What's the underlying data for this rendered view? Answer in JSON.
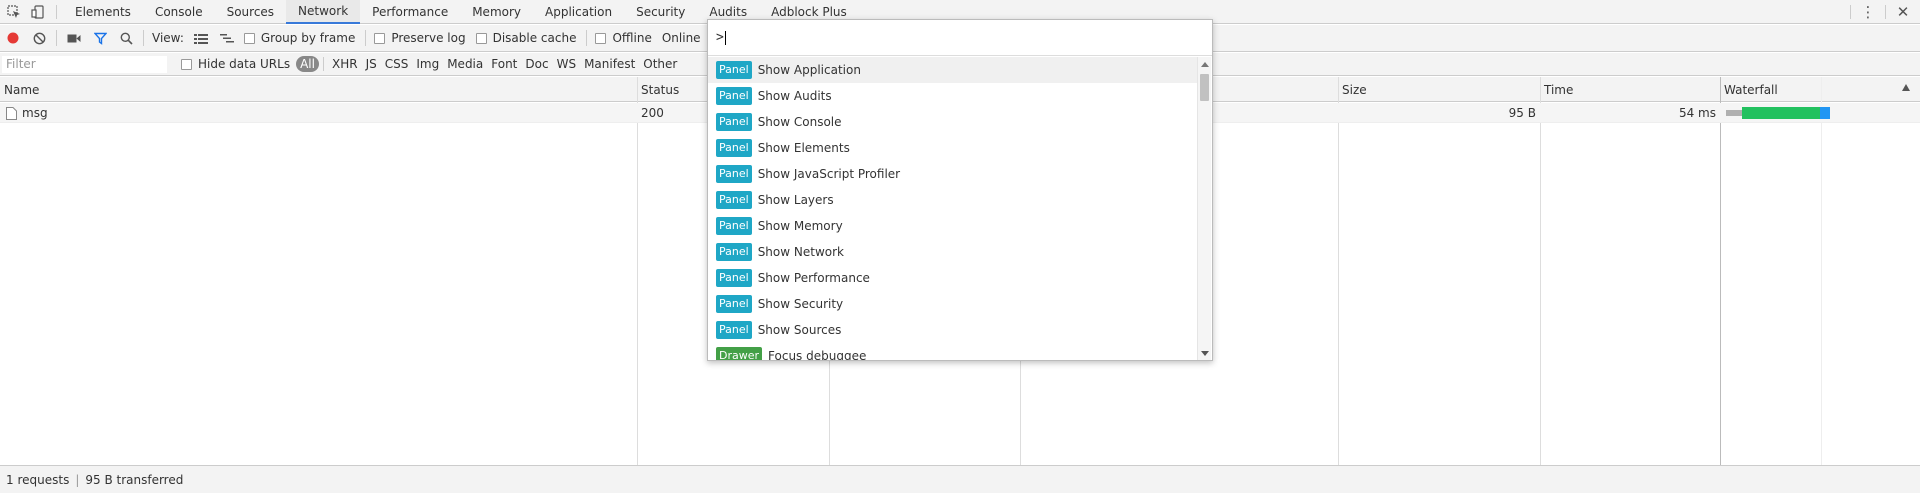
{
  "tabs": [
    {
      "label": "Elements"
    },
    {
      "label": "Console"
    },
    {
      "label": "Sources"
    },
    {
      "label": "Network"
    },
    {
      "label": "Performance"
    },
    {
      "label": "Memory"
    },
    {
      "label": "Application"
    },
    {
      "label": "Security"
    },
    {
      "label": "Audits"
    },
    {
      "label": "Adblock Plus"
    }
  ],
  "selected_tab": "Network",
  "toolbar": {
    "view_label": "View:",
    "group_by_frame": "Group by frame",
    "preserve_log": "Preserve log",
    "disable_cache": "Disable cache",
    "offline": "Offline",
    "throttle": "Online"
  },
  "filter": {
    "placeholder": "Filter",
    "hide_data_urls": "Hide data URLs",
    "types": [
      "All",
      "XHR",
      "JS",
      "CSS",
      "Img",
      "Media",
      "Font",
      "Doc",
      "WS",
      "Manifest",
      "Other"
    ]
  },
  "columns": {
    "name": "Name",
    "status": "Status",
    "size": "Size",
    "time": "Time",
    "waterfall": "Waterfall"
  },
  "rows": [
    {
      "name": "msg",
      "status": "200",
      "size": "95 B",
      "time": "54 ms"
    }
  ],
  "status_bar": {
    "requests": "1 requests",
    "transferred": "95 B transferred"
  },
  "command_menu": {
    "query": ">",
    "items": [
      {
        "badge": "Panel",
        "label": "Show Application"
      },
      {
        "badge": "Panel",
        "label": "Show Audits"
      },
      {
        "badge": "Panel",
        "label": "Show Console"
      },
      {
        "badge": "Panel",
        "label": "Show Elements"
      },
      {
        "badge": "Panel",
        "label": "Show JavaScript Profiler"
      },
      {
        "badge": "Panel",
        "label": "Show Layers"
      },
      {
        "badge": "Panel",
        "label": "Show Memory"
      },
      {
        "badge": "Panel",
        "label": "Show Network"
      },
      {
        "badge": "Panel",
        "label": "Show Performance"
      },
      {
        "badge": "Panel",
        "label": "Show Security"
      },
      {
        "badge": "Panel",
        "label": "Show Sources"
      },
      {
        "badge": "Drawer",
        "label": "Focus debuggee"
      }
    ]
  },
  "colors": {
    "panel_badge": "#1fa7c6",
    "drawer_badge": "#43a047",
    "record": "#e53935",
    "filter_active": "#1a73e8",
    "selected_tab_underline": "#3879d9",
    "waterfall_wait": "#22c15f",
    "waterfall_download": "#2196f3",
    "waterfall_queue": "#b0b0b0"
  }
}
